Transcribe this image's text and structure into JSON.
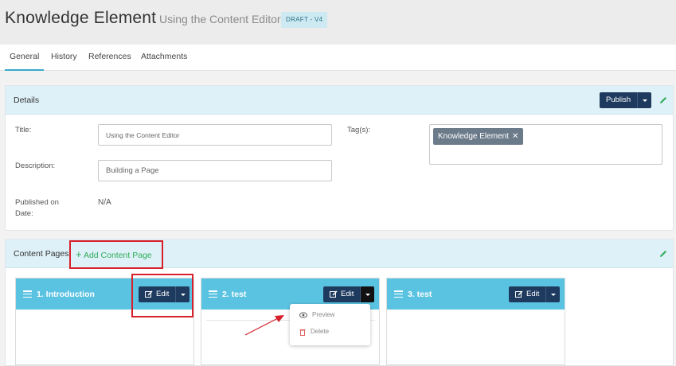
{
  "header": {
    "title": "Knowledge Element",
    "subtitle": "Using the Content Editor",
    "badge": "DRAFT - V4"
  },
  "tabs": [
    {
      "label": "General",
      "active": true
    },
    {
      "label": "History",
      "active": false
    },
    {
      "label": "References",
      "active": false
    },
    {
      "label": "Attachments",
      "active": false
    }
  ],
  "details": {
    "heading": "Details",
    "publish_label": "Publish",
    "title_label": "Title:",
    "title_value": "Using the Content Editor",
    "description_label": "Description:",
    "description_value": "Building a Page",
    "published_label": "Published on Date:",
    "published_value": "N/A",
    "tags_label": "Tag(s):",
    "tags": [
      "Knowledge Element"
    ]
  },
  "content_pages": {
    "heading": "Content Pages",
    "add_label": "Add Content Page",
    "pages": [
      {
        "title": "1. Introduction",
        "edit_label": "Edit"
      },
      {
        "title": "2. test",
        "edit_label": "Edit"
      },
      {
        "title": "3. test",
        "edit_label": "Edit"
      }
    ],
    "dropdown": {
      "preview_label": "Preview",
      "delete_label": "Delete"
    }
  },
  "colors": {
    "accent": "#5bc3e2",
    "button_dark": "#1f3a5f",
    "add_green": "#2cac56",
    "highlight_red": "#d6202a"
  },
  "icons": [
    "pencil-icon",
    "caret-down-icon",
    "plus-icon",
    "edit-icon",
    "hamburger-icon",
    "eye-icon",
    "trash-icon",
    "close-icon"
  ]
}
